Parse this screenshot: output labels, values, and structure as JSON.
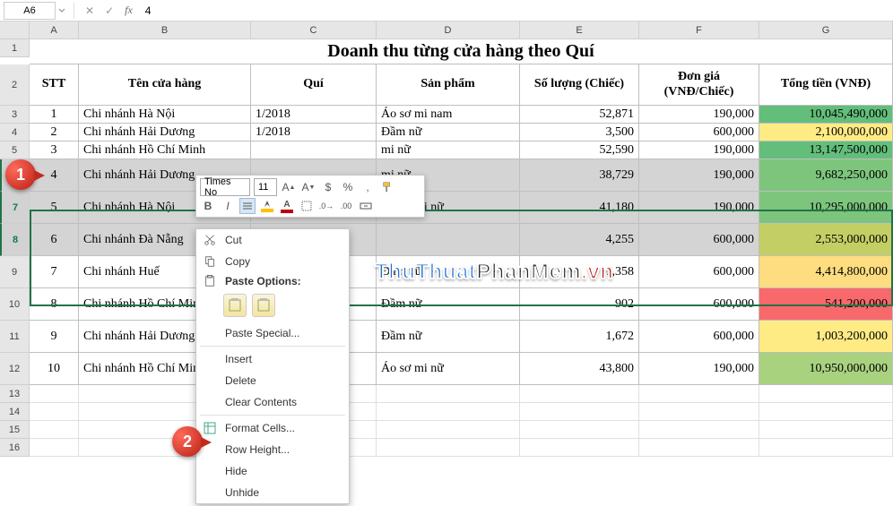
{
  "name_box": "A6",
  "formula_value": "4",
  "columns": [
    "A",
    "B",
    "C",
    "D",
    "E",
    "F",
    "G"
  ],
  "title": "Doanh thu từng cửa hàng theo Quí",
  "headers": {
    "stt": "STT",
    "store": "Tên cửa hàng",
    "quarter": "Quí",
    "product": "Sản phẩm",
    "qty": "Số lượng (Chiếc)",
    "price": "Đơn giá (VNĐ/Chiếc)",
    "total": "Tổng tiền (VNĐ)"
  },
  "rows": [
    {
      "n": "1",
      "store": "Chi nhánh Hà Nội",
      "q": "1/2018",
      "p": "Áo sơ mi nam",
      "qty": "52,871",
      "price": "190,000",
      "total": "10,045,490,000",
      "cls": "hgreen"
    },
    {
      "n": "2",
      "store": "Chi nhánh Hải Dương",
      "q": "1/2018",
      "p": "Đầm nữ",
      "qty": "3,500",
      "price": "600,000",
      "total": "2,100,000,000",
      "cls": "hyellow"
    },
    {
      "n": "3",
      "store": "Chi nhánh Hồ Chí Minh",
      "q": "",
      "p": "mi nữ",
      "qty": "52,590",
      "price": "190,000",
      "total": "13,147,500,000",
      "cls": "hgreen"
    },
    {
      "n": "4",
      "store": "Chi nhánh Hải Dương",
      "q": "",
      "p": "mi nữ",
      "qty": "38,729",
      "price": "190,000",
      "total": "9,682,250,000",
      "cls": "hgreen2"
    },
    {
      "n": "5",
      "store": "Chi nhánh Hà Nội",
      "q": "",
      "p": "Áo sơ mi nữ",
      "qty": "41,180",
      "price": "190,000",
      "total": "10,295,000,000",
      "cls": "hgreen2"
    },
    {
      "n": "6",
      "store": "Chi nhánh Đà Nẵng",
      "q": "",
      "p": "",
      "qty": "4,255",
      "price": "600,000",
      "total": "2,553,000,000",
      "cls": "holive"
    },
    {
      "n": "7",
      "store": "Chi nhánh Huế",
      "q": "",
      "p": "Đầm nữ",
      "qty": "7,358",
      "price": "600,000",
      "total": "4,414,800,000",
      "cls": "hyellow2"
    },
    {
      "n": "8",
      "store": "Chi nhánh Hồ Chí Minh",
      "q": "",
      "p": "Đầm nữ",
      "qty": "902",
      "price": "600,000",
      "total": "541,200,000",
      "cls": "hred"
    },
    {
      "n": "9",
      "store": "Chi nhánh Hải Dương",
      "q": "",
      "p": "Đầm nữ",
      "qty": "1,672",
      "price": "600,000",
      "total": "1,003,200,000",
      "cls": "hyellow"
    },
    {
      "n": "10",
      "store": "Chi nhánh Hồ Chí Minh",
      "q": "",
      "p": "Áo sơ mi nữ",
      "qty": "43,800",
      "price": "190,000",
      "total": "10,950,000,000",
      "cls": "hlime"
    }
  ],
  "mini_toolbar": {
    "font": "Times No",
    "size": "11"
  },
  "context_menu": {
    "cut": "Cut",
    "copy": "Copy",
    "paste_options": "Paste Options:",
    "paste_special": "Paste Special...",
    "insert": "Insert",
    "delete": "Delete",
    "clear": "Clear Contents",
    "format": "Format Cells...",
    "row_height": "Row Height...",
    "hide": "Hide",
    "unhide": "Unhide"
  },
  "badges": {
    "one": "1",
    "two": "2"
  },
  "watermark": {
    "a": "ThuThuat",
    "b": "PhanMem",
    "c": ".vn"
  }
}
